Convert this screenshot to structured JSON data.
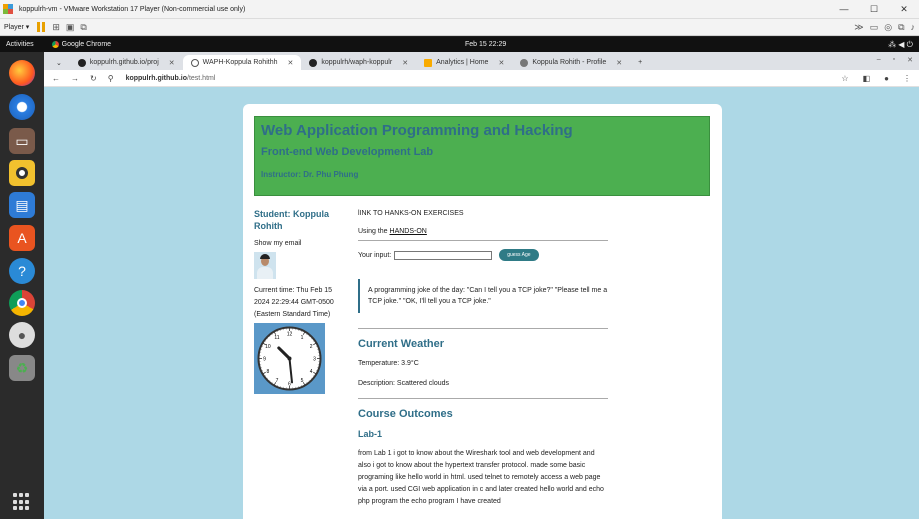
{
  "vm": {
    "title": "koppulrh-vm - VMware Workstation 17 Player (Non-commercial use only)",
    "player_label": "Player ▾",
    "min": "—",
    "max": "☐",
    "close": "✕"
  },
  "gnome": {
    "activities": "Activities",
    "app_name": "Google Chrome",
    "clock": "Feb 15  22:29"
  },
  "tabs": [
    {
      "label": "koppulrh.github.io/proj",
      "active": false
    },
    {
      "label": "WAPH-Koppula Rohithh",
      "active": true
    },
    {
      "label": "koppulrh/waph-koppulr",
      "active": false
    },
    {
      "label": "Analytics | Home",
      "active": false
    },
    {
      "label": "Koppula Rohith - Profile",
      "active": false
    }
  ],
  "address": {
    "host": "koppulrh.github.io",
    "path": "/test.html"
  },
  "page": {
    "title": "Web Application Programming and Hacking",
    "subtitle": "Front-end Web Development Lab",
    "instructor": "Instructor: Dr. Phu Phung",
    "student": "Student: Koppula Rohith",
    "show_email": "Show my email",
    "time_line1": "Current time: Thu Feb 15",
    "time_line2": "2024 22:29:44 GMT-0500",
    "time_line3": "(Eastern Standard Time)",
    "link_intro": "lINK TO HANKS-ON EXERCISES",
    "using_prefix": "Using the ",
    "using_link": "HANDS-ON",
    "input_label": "Your input:",
    "guess_button": "guess Age",
    "joke": "A programming joke of the day: \"Can I tell you a TCP joke?\" \"Please tell me a TCP joke.\" \"OK, I'll tell you a TCP joke.\"",
    "weather_title": "Current Weather",
    "temperature": "Temperature: 3.9°C",
    "description": "Description: Scattered clouds",
    "outcomes_title": "Course Outcomes",
    "lab1_title": "Lab-1",
    "lab1_text": "from Lab 1 i got to know about the Wireshark tool and web development and also i got to know about the hypertext transfer protocol. made some basic programing like hello world in html. used telnet to remotely access a web page via a port. used CGI web application in c and later created hello world and echo php program the echo program I have created"
  },
  "clock_face": {
    "hour": 10,
    "minute": 29
  },
  "colors": {
    "page_bg": "#add8e6",
    "banner": "#4caf50",
    "heading": "#2f6e88",
    "button": "#2f7b86"
  }
}
